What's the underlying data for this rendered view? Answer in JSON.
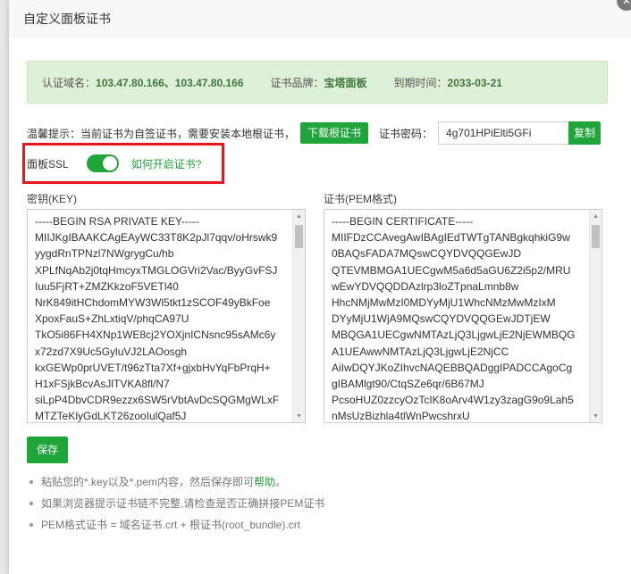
{
  "dialog": {
    "title": "自定义面板证书",
    "close_glyph": "✕"
  },
  "info": {
    "domain_label": "认证域名：",
    "domain_value": "103.47.80.166、103.47.80.166",
    "brand_label": "证书品牌：",
    "brand_value": "宝塔面板",
    "expire_label": "到期时间：",
    "expire_value": "2033-03-21"
  },
  "hint": {
    "text": "温馨提示：当前证书为自签证书，需要安装本地根证书，",
    "download_label": "下载根证书",
    "password_label": "证书密码：",
    "password_value": "4g701HPiElti5GFi",
    "copy_label": "复制"
  },
  "ssl": {
    "label": "面板SSL",
    "enabled": true,
    "how_link": "如何开启证书?"
  },
  "key": {
    "label": "密钥(KEY)",
    "lines": [
      "-----BEGIN RSA PRIVATE KEY-----",
      "MIIJKgIBAAKCAgEAyWC33T8K2pJl7qqv/oHrswk9",
      "yygdRnTPNzl7NWgrygCu/hb",
      "XPLfNqAb2j0tqHmcyxTMGLOGVri2Vac/ByyGvFSJ",
      "Iuu5FjRT+ZMZKkzoF5VETl40",
      "NrK849itHChdomMYW3Wl5tkt1zSCOF49yBkFoe",
      "XpoxFauS+ZhLxtiqV/phqCA97U",
      "TkO5i86FH4XNp1WE8cj2YOXjnICNsnc95sAMc6y",
      "x72zd7X9Uc5GyluVJ2LAOosgh",
      "kxGEWp0prUVET/t96zTta7Xf+gjxbHvYqFbPrqH+",
      "H1xFSjkBcvAsJlTVKA8fl/N7",
      "siLpP4DbvCDR9ezzx6SW5rVbtAvDcSQGMgWLxF",
      "MTZTeKlyGdLKT26zooIulQaf5J"
    ]
  },
  "cert": {
    "label": "证书(PEM格式)",
    "lines": [
      "-----BEGIN CERTIFICATE-----",
      "MIIFDzCCAvegAwIBAgIEdTWTgTANBgkqhkiG9w",
      "0BAQsFADA7MQswCQYDVQQGEwJD",
      "QTEVMBMGA1UECgwM5a6d5aGU6Z2i5p2/MRU",
      "wEwYDVQQDDAzlrp3loZTpnaLmnb8w",
      "HhcNMjMwMzI0MDYyMjU1WhcNMzMwMzIxM",
      "DYyMjU1WjA9MQswCQYDVQQGEwJDTjEW",
      "MBQGA1UECgwNMTAzLjQ3LjgwLjE2NjEWMBQG",
      "A1UEAwwNMTAzLjQ3LjgwLjE2NjCC",
      "AiIwDQYJKoZIhvcNAQEBBQADggIPADCCAgoCg",
      "gIBAMlgt90/CtqSZe6qr/6B67MJ",
      "PcsoHUZ0zzcyOzTcIK8oArv4W1zy3zagG9o9Lah5",
      "nMsUzBizhla4tlWnPwcshrxU"
    ]
  },
  "save_label": "保存",
  "tips": {
    "tip1_before": "粘贴您的*.key以及*.pem内容，然后保存即可",
    "tip1_link": "帮助",
    "tip1_after": "。",
    "tip2": "如果浏览器提示证书链不完整,请检查是否正确拼接PEM证书",
    "tip3": "PEM格式证书 = 域名证书.crt + 根证书(root_bundle).crt"
  }
}
